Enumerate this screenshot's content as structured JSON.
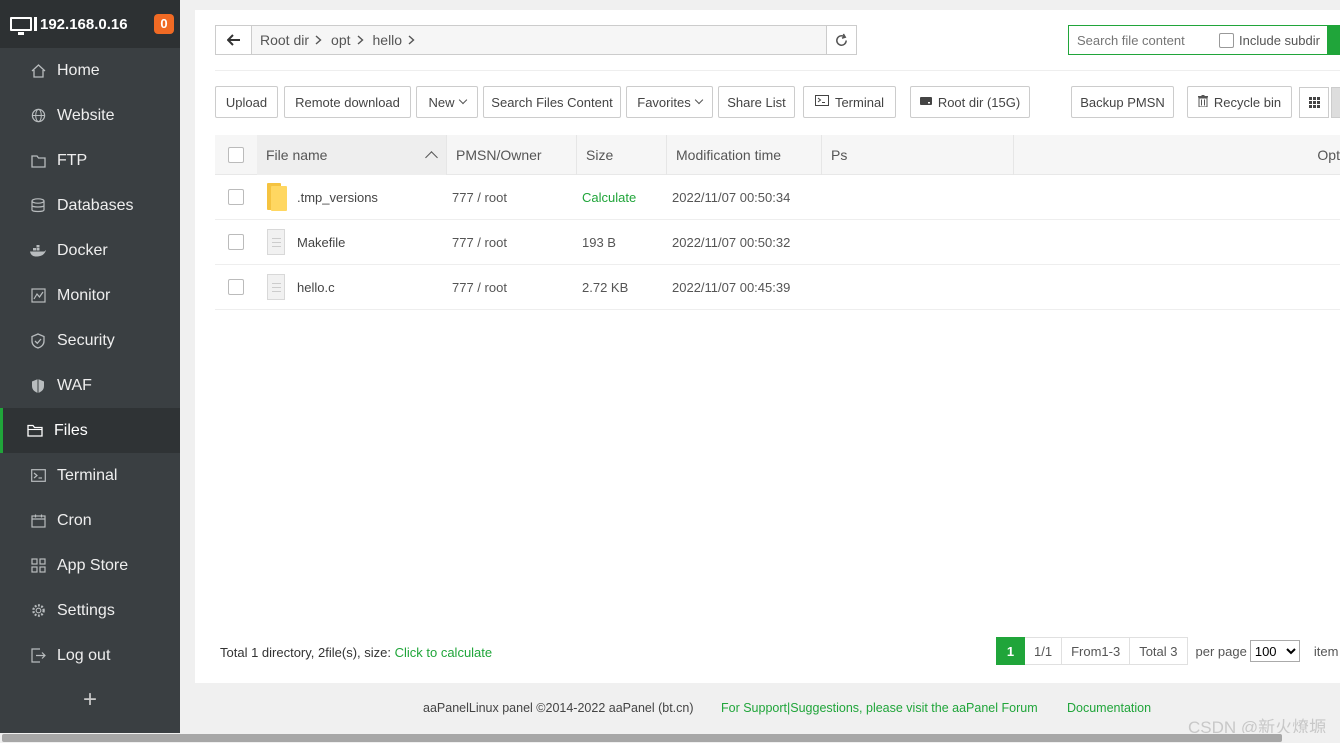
{
  "sidebar": {
    "ip": "192.168.0.16",
    "badge": "0",
    "items": [
      {
        "label": "Home",
        "icon": "home-icon"
      },
      {
        "label": "Website",
        "icon": "globe-icon"
      },
      {
        "label": "FTP",
        "icon": "ftp-icon"
      },
      {
        "label": "Databases",
        "icon": "database-icon"
      },
      {
        "label": "Docker",
        "icon": "docker-icon"
      },
      {
        "label": "Monitor",
        "icon": "monitor-icon"
      },
      {
        "label": "Security",
        "icon": "shield-icon"
      },
      {
        "label": "WAF",
        "icon": "waf-shield-icon"
      },
      {
        "label": "Files",
        "icon": "folder-icon"
      },
      {
        "label": "Terminal",
        "icon": "terminal-icon"
      },
      {
        "label": "Cron",
        "icon": "calendar-icon"
      },
      {
        "label": "App Store",
        "icon": "apps-grid-icon"
      },
      {
        "label": "Settings",
        "icon": "gear-icon"
      },
      {
        "label": "Log out",
        "icon": "logout-icon"
      }
    ],
    "active_item": "Files",
    "add_label": "+"
  },
  "pathbar": {
    "crumbs": [
      "Root dir",
      "opt",
      "hello"
    ]
  },
  "search": {
    "placeholder": "Search file content",
    "include_subdir": "Include subdir"
  },
  "toolbar": {
    "upload": "Upload",
    "remote_download": "Remote download",
    "new": "New",
    "search_files_content": "Search Files Content",
    "favorites": "Favorites",
    "share_list": "Share List",
    "terminal": "Terminal",
    "root_dir": "Root dir (15G)",
    "backup_pmsn": "Backup PMSN",
    "recycle_bin": "Recycle bin"
  },
  "table": {
    "columns": [
      "File name",
      "PMSN/Owner",
      "Size",
      "Modification time",
      "Ps",
      "Opt"
    ],
    "rows": [
      {
        "name": ".tmp_versions",
        "type": "folder",
        "perm": "777 / root",
        "size": "Calculate",
        "time": "2022/11/07 00:50:34"
      },
      {
        "name": "Makefile",
        "type": "file",
        "perm": "777 / root",
        "size": "193 B",
        "time": "2022/11/07 00:50:32"
      },
      {
        "name": "hello.c",
        "type": "file",
        "perm": "777 / root",
        "size": "2.72 KB",
        "time": "2022/11/07 00:45:39"
      }
    ]
  },
  "summary": {
    "text": "Total 1 directory, 2file(s), size: ",
    "link": "Click to calculate"
  },
  "pager": {
    "current": "1",
    "pages": "1/1",
    "range": "From1-3",
    "total": "Total 3",
    "per_page_label": "per page",
    "per_page_value": "100",
    "items_label": "item"
  },
  "footer": {
    "copyright": "aaPanelLinux panel ©2014-2022 aaPanel (bt.cn)",
    "support": "For Support|Suggestions, please visit the aaPanel Forum",
    "docs": "Documentation"
  },
  "watermark": "CSDN @新火燎塬",
  "colors": {
    "accent": "#20a53a",
    "sidebar_bg": "#3a3f42",
    "badge": "#f06a24"
  }
}
